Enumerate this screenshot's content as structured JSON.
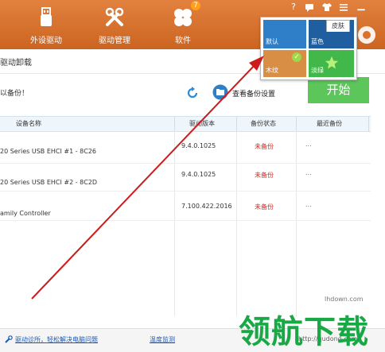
{
  "nav": {
    "items": [
      {
        "label": "外设驱动",
        "icon": "usb-icon"
      },
      {
        "label": "驱动管理",
        "icon": "tools-icon"
      },
      {
        "label": "软件",
        "icon": "apps-icon",
        "badge": "7"
      }
    ]
  },
  "window_controls": {
    "help": "?",
    "chat": "chat-icon",
    "skin": "shirt-icon",
    "menu": "menu-icon"
  },
  "page": {
    "title": "驱动卸载",
    "backup_notice": "以备份！",
    "view_backup": "查看备份设置",
    "start": "开始"
  },
  "table": {
    "headers": [
      "设备名称",
      "驱动版本",
      "备份状态",
      "最近备份"
    ],
    "rows": [
      {
        "name": "20 Series USB EHCI #1 - 8C26",
        "version": "9.4.0.1025",
        "status": "未备份",
        "last": "..."
      },
      {
        "name": "20 Series USB EHCI #2 - 8C2D",
        "version": "9.4.0.1025",
        "status": "未备份",
        "last": "..."
      },
      {
        "name": "amily Controller",
        "version": "7.100.422.2016",
        "status": "未备份",
        "last": "..."
      }
    ]
  },
  "footer": {
    "diagnose": "驱动诊所，轻松解决电脑问题",
    "temp": "温度监测",
    "url": "http://qudong.com"
  },
  "skin_popup": {
    "tab": "皮肤",
    "tiles": [
      {
        "label": "默认",
        "color": "#2f7ec8"
      },
      {
        "label": "蓝色",
        "color": "#1f5fa0"
      },
      {
        "label": "木纹",
        "color": "#d98e45"
      },
      {
        "label": "淡绿",
        "color": "#43b84a"
      }
    ],
    "selected_check": "✓"
  },
  "watermark": {
    "text": "领航下载",
    "site": "lhdown.com"
  },
  "colors": {
    "topbar": "#d9702c",
    "start_green": "#5cc65a",
    "status_red": "#d9261c",
    "arrow": "#cc1c1c"
  }
}
